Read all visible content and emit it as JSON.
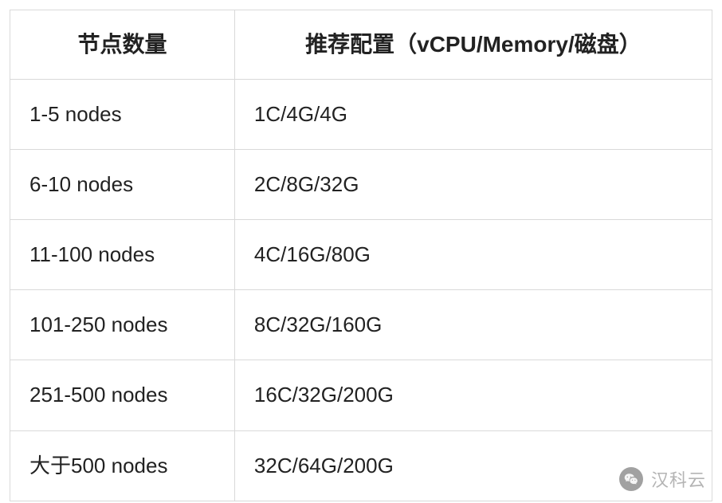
{
  "table": {
    "headers": [
      "节点数量",
      "推荐配置（vCPU/Memory/磁盘）"
    ],
    "rows": [
      {
        "nodes": "1-5 nodes",
        "config": "1C/4G/4G"
      },
      {
        "nodes": "6-10 nodes",
        "config": "2C/8G/32G"
      },
      {
        "nodes": "11-100 nodes",
        "config": "4C/16G/80G"
      },
      {
        "nodes": "101-250 nodes",
        "config": "8C/32G/160G"
      },
      {
        "nodes": "251-500 nodes",
        "config": "16C/32G/200G"
      },
      {
        "nodes": "大于500 nodes",
        "config": "32C/64G/200G"
      }
    ]
  },
  "watermark": {
    "text": "汉科云",
    "icon": "wechat-icon"
  }
}
